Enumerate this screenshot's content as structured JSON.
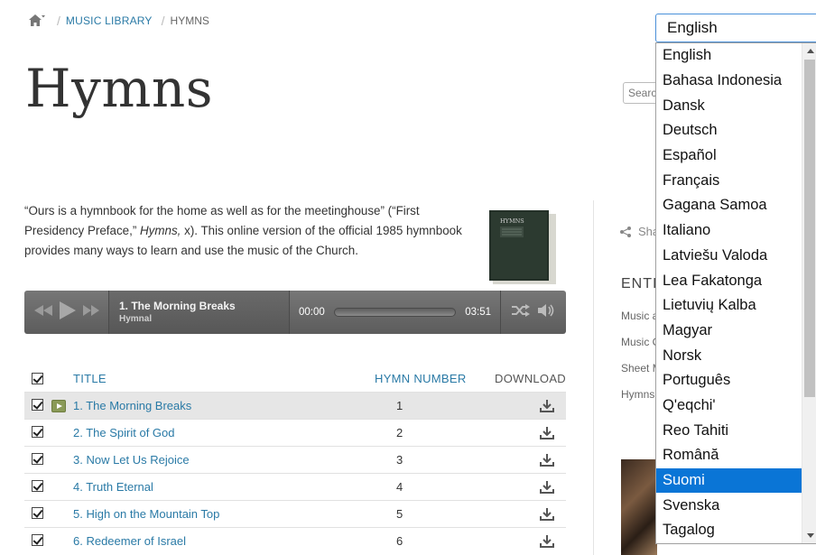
{
  "breadcrumb": {
    "home_icon": "home-icon",
    "items": [
      "MUSIC LIBRARY",
      "HYMNS"
    ]
  },
  "page_title": "Hymns",
  "search": {
    "placeholder": "Search"
  },
  "intro": {
    "part1": "“Ours is a hymnbook for the home as well as for the meetinghouse” (“First Presidency Preface,” ",
    "emph": "Hymns,",
    "part2": " x). This online version of the official 1985 hymnbook provides many ways to learn and use the music of the Church.",
    "book_label": "HYMNS"
  },
  "player": {
    "track_title": "1. The Morning Breaks",
    "track_sub": "Hymnal",
    "time_current": "00:00",
    "time_total": "03:51",
    "progress": 0
  },
  "table": {
    "headers": {
      "title": "TITLE",
      "number": "HYMN NUMBER",
      "download": "DOWNLOAD"
    },
    "rows": [
      {
        "title": "1. The Morning Breaks",
        "number": "1"
      },
      {
        "title": "2. The Spirit of God",
        "number": "2"
      },
      {
        "title": "3. Now Let Us Rejoice",
        "number": "3"
      },
      {
        "title": "4. Truth Eternal",
        "number": "4"
      },
      {
        "title": "5. High on the Mountain Top",
        "number": "5"
      },
      {
        "title": "6. Redeemer of Israel",
        "number": "6"
      }
    ]
  },
  "sidebar": {
    "share": "Sha",
    "heading": "ENTI",
    "links": [
      "Music a",
      "Music C",
      "Sheet M",
      "Hymns"
    ]
  },
  "language": {
    "selected": "English",
    "highlighted": "Suomi",
    "options": [
      "English",
      "Bahasa Indonesia",
      "Dansk",
      "Deutsch",
      "Español",
      "Français",
      "Gagana Samoa",
      "Italiano",
      "Latviešu Valoda",
      "Lea Fakatonga",
      "Lietuvių Kalba",
      "Magyar",
      "Norsk",
      "Português",
      "Q'eqchi'",
      "Reo Tahiti",
      "Română",
      "Suomi",
      "Svenska",
      "Tagalog"
    ]
  },
  "colors": {
    "link": "#2a7aa6",
    "highlight": "#0a75d6",
    "player": "#666666",
    "play_badge": "#8a9a57"
  }
}
